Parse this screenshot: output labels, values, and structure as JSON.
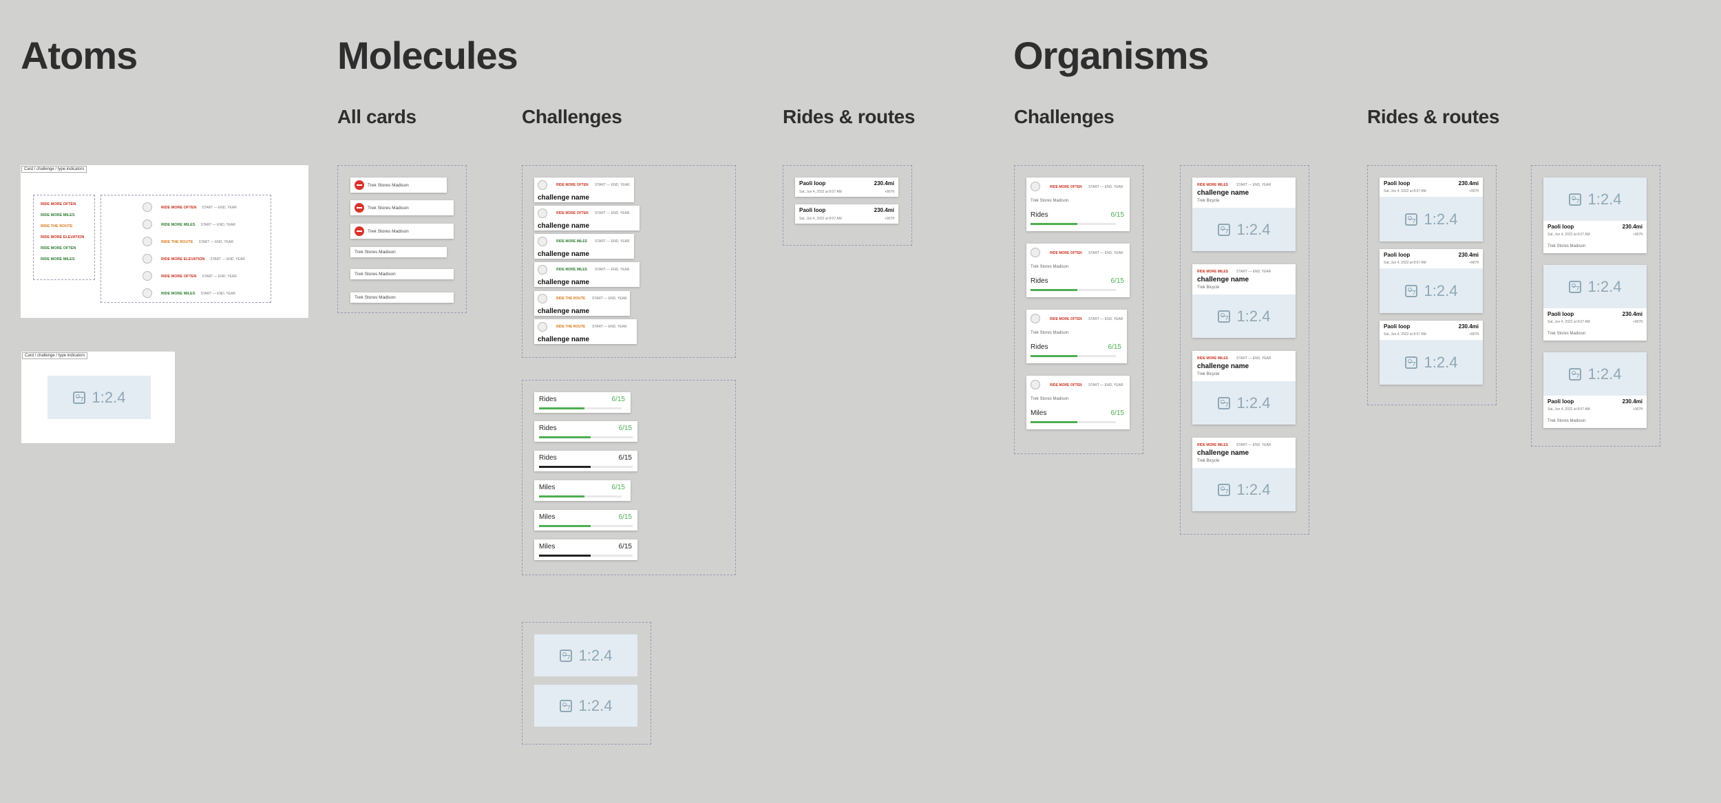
{
  "titles": {
    "atoms": "Atoms",
    "molecules": "Molecules",
    "organisms": "Organisms"
  },
  "subtitles": {
    "all_cards": "All cards",
    "challenges": "Challenges",
    "rides_routes": "Rides & routes"
  },
  "atoms": {
    "frame1_label": "Card / challenge / type indicators",
    "frame2_label": "Card / challenge / type indicators",
    "left_types": [
      "RIDE MORE OFTEN",
      "RIDE MORE MILES",
      "RIDE THE ROUTE",
      "RIDE MORE ELEVATION",
      "RIDE MORE OFTEN",
      "RIDE MORE MILES"
    ],
    "right_rows": [
      {
        "type": "RIDE MORE OFTEN",
        "dates": "START — END, YEAR"
      },
      {
        "type": "RIDE MORE MILES",
        "dates": "START — END, YEAR"
      },
      {
        "type": "RIDE THE ROUTE",
        "dates": "START — END, YEAR"
      },
      {
        "type": "RIDE MORE ELEVATION",
        "dates": "START — END, YEAR"
      },
      {
        "type": "RIDE MORE OFTEN",
        "dates": "START — END, YEAR"
      },
      {
        "type": "RIDE MORE MILES",
        "dates": "START — END, YEAR"
      }
    ],
    "image_ratio": "1:2.4"
  },
  "all_cards": [
    "Trek Stores Madison",
    "Trek Stores Madison",
    "Trek Stores Madison",
    "Trek Stores Madison",
    "Trek Stores Madison",
    "Trek Stores Madison"
  ],
  "mol_challenges": {
    "cards": [
      {
        "type": "RIDE MORE OFTEN",
        "dates": "START — END, YEAR",
        "name": "challenge name"
      },
      {
        "type": "RIDE MORE OFTEN",
        "dates": "START — END, YEAR",
        "name": "challenge name"
      },
      {
        "type": "RIDE MORE MILES",
        "dates": "START — END, YEAR",
        "name": "challenge name"
      },
      {
        "type": "RIDE MORE MILES",
        "dates": "START — END, YEAR",
        "name": "challenge name"
      },
      {
        "type": "RIDE THE ROUTE",
        "dates": "START — END, YEAR",
        "name": "challenge name"
      },
      {
        "type": "RIDE THE ROUTE",
        "dates": "START — END, YEAR",
        "name": "challenge name"
      }
    ],
    "progress": [
      {
        "label": "Rides",
        "value": "6/15",
        "fraction": 0.55,
        "color": "#4caf50"
      },
      {
        "label": "Rides",
        "value": "6/15",
        "fraction": 0.55,
        "color": "#4caf50"
      },
      {
        "label": "Rides",
        "value": "6/15",
        "fraction": 0.55,
        "color": "#222222"
      },
      {
        "label": "Miles",
        "value": "6/15",
        "fraction": 0.55,
        "color": "#4caf50"
      },
      {
        "label": "Miles",
        "value": "6/15",
        "fraction": 0.55,
        "color": "#4caf50"
      },
      {
        "label": "Miles",
        "value": "6/15",
        "fraction": 0.55,
        "color": "#222222"
      }
    ],
    "image_ratio": "1:2.4"
  },
  "mol_rides": [
    {
      "name": "Paoli loop",
      "distance": "230.4mi",
      "date": "Sat, Jun 4, 2022 at 8:07 AM",
      "delta": "+907ft"
    },
    {
      "name": "Paoli loop",
      "distance": "230.4mi",
      "date": "Sat, Jun 4, 2022 at 8:07 AM",
      "delta": "+907ft"
    }
  ],
  "org_challenges": [
    {
      "type": "RIDE MORE OFTEN",
      "dates": "START — END, YEAR",
      "store": "Trek Stores Madison",
      "label": "Rides",
      "value": "6/15",
      "fraction": 0.55
    },
    {
      "type": "RIDE MORE OFTEN",
      "dates": "START — END, YEAR",
      "store": "Trek Stores Madison",
      "label": "Rides",
      "value": "6/15",
      "fraction": 0.55
    },
    {
      "type": "RIDE MORE OFTEN",
      "dates": "START — END, YEAR",
      "store": "Trek Stores Madison",
      "label": "Rides",
      "value": "6/15",
      "fraction": 0.55
    },
    {
      "type": "RIDE MORE OFTEN",
      "dates": "START — END, YEAR",
      "store": "Trek Stores Madison",
      "label": "Miles",
      "value": "6/15",
      "fraction": 0.55
    }
  ],
  "org_challenge_images": [
    {
      "type": "RIDE MORE MILES",
      "dates": "START — END, YEAR",
      "name": "challenge name",
      "brand": "Trek Bicycle",
      "ratio": "1:2.4"
    },
    {
      "type": "RIDE MORE MILES",
      "dates": "START — END, YEAR",
      "name": "challenge name",
      "brand": "Trek Bicycle",
      "ratio": "1:2.4"
    },
    {
      "type": "RIDE MORE MILES",
      "dates": "START — END, YEAR",
      "name": "challenge name",
      "brand": "Trek Bicycle",
      "ratio": "1:2.4"
    },
    {
      "type": "RIDE MORE MILES",
      "dates": "START — END, YEAR",
      "name": "challenge name",
      "brand": "Trek Bicycle",
      "ratio": "1:2.4"
    }
  ],
  "org_rides_a": [
    {
      "name": "Paoli loop",
      "distance": "230.4mi",
      "date": "Sat, Jun 4, 2022 at 8:07 AM",
      "delta": "+907ft",
      "ratio": "1:2.4"
    },
    {
      "name": "Paoli loop",
      "distance": "230.4mi",
      "date": "Sat, Jun 4, 2022 at 8:07 AM",
      "delta": "+907ft",
      "ratio": "1:2.4"
    },
    {
      "name": "Paoli loop",
      "distance": "230.4mi",
      "date": "Sat, Jun 4, 2022 at 8:07 AM",
      "delta": "+907ft",
      "ratio": "1:2.4"
    }
  ],
  "org_rides_b": [
    {
      "name": "Paoli loop",
      "distance": "230.4mi",
      "date": "Sat, Jun 4, 2022 at 8:07 AM",
      "delta": "+907ft",
      "store": "Trek Stores Madison",
      "ratio": "1:2.4"
    },
    {
      "name": "Paoli loop",
      "distance": "230.4mi",
      "date": "Sat, Jun 4, 2022 at 8:07 AM",
      "delta": "+907ft",
      "store": "Trek Stores Madison",
      "ratio": "1:2.4"
    },
    {
      "name": "Paoli loop",
      "distance": "230.4mi",
      "date": "Sat, Jun 4, 2022 at 8:07 AM",
      "delta": "+907ft",
      "store": "Trek Stores Madison",
      "ratio": "1:2.4"
    }
  ]
}
